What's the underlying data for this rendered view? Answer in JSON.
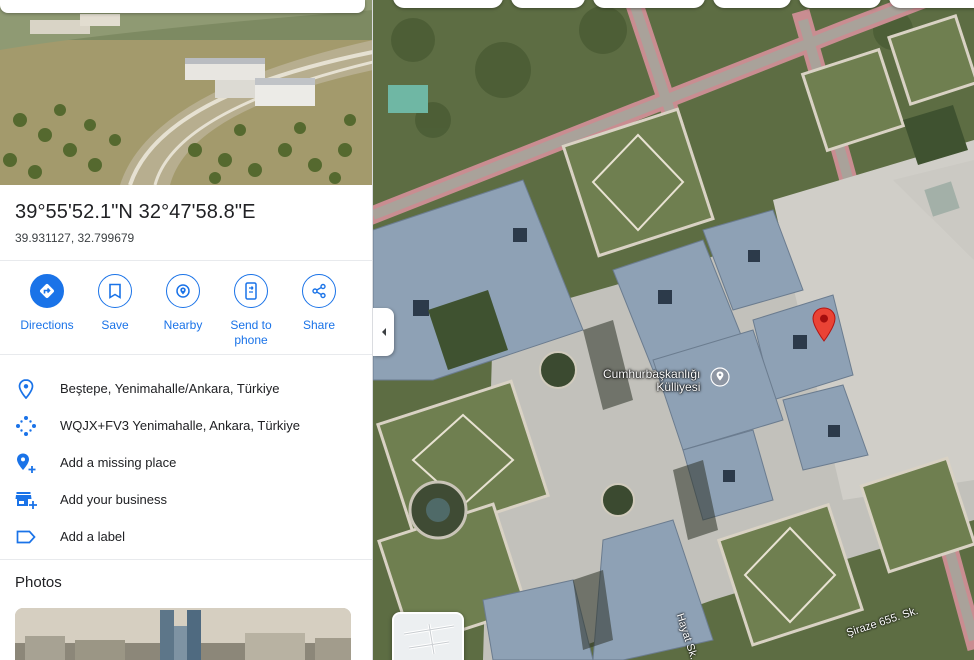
{
  "place": {
    "coords_dms": "39°55'52.1\"N 32°47'58.8\"E",
    "coords_decimal": "39.931127, 32.799679"
  },
  "actions": [
    {
      "label": "Directions",
      "icon": "directions-icon"
    },
    {
      "label": "Save",
      "icon": "bookmark-icon"
    },
    {
      "label": "Nearby",
      "icon": "nearby-icon"
    },
    {
      "label": "Send to phone",
      "icon": "send-to-phone-icon"
    },
    {
      "label": "Share",
      "icon": "share-icon"
    }
  ],
  "info": [
    {
      "text": "Beştepe, Yenimahalle/Ankara, Türkiye",
      "icon": "location-pin-icon"
    },
    {
      "text": "WQJX+FV3 Yenimahalle, Ankara, Türkiye",
      "icon": "plus-code-icon"
    },
    {
      "text": "Add a missing place",
      "icon": "add-place-icon"
    },
    {
      "text": "Add your business",
      "icon": "add-business-icon"
    },
    {
      "text": "Add a label",
      "icon": "label-icon"
    }
  ],
  "photos_heading": "Photos",
  "map": {
    "place_label_line1": "Cumhurbaşkanlığı",
    "place_label_line2": "Külliyesi",
    "road_1": "Hayat Sk.",
    "road_2": "Şiraze 655. Sk.",
    "accent_color": "#1a73e8",
    "pin_color": "#ea4335"
  }
}
